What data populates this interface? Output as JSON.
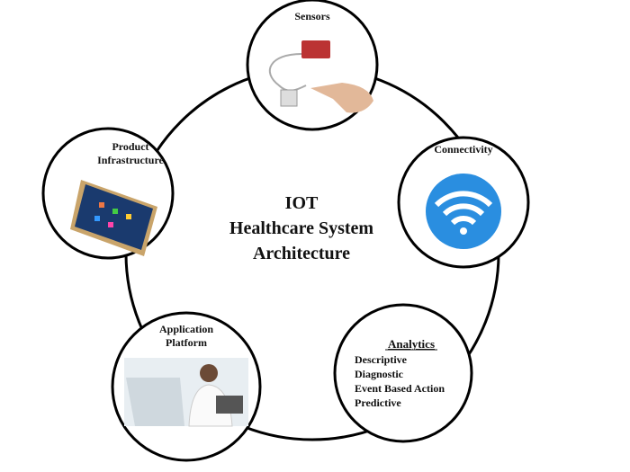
{
  "title": [
    "IOT",
    "Healthcare System",
    "Architecture"
  ],
  "nodes": {
    "sensors": {
      "label": "Sensors"
    },
    "connectivity": {
      "label": "Connectivity",
      "icon": "wifi-icon",
      "color": "#2a8ee0"
    },
    "analytics": {
      "label": "Analytics",
      "items": [
        "Descriptive",
        "Diagnostic",
        "Event Based Action",
        "Predictive"
      ]
    },
    "application": {
      "label": [
        "Application",
        "Platform"
      ]
    },
    "product": {
      "label": [
        "Product",
        "Infrastructure"
      ]
    }
  }
}
